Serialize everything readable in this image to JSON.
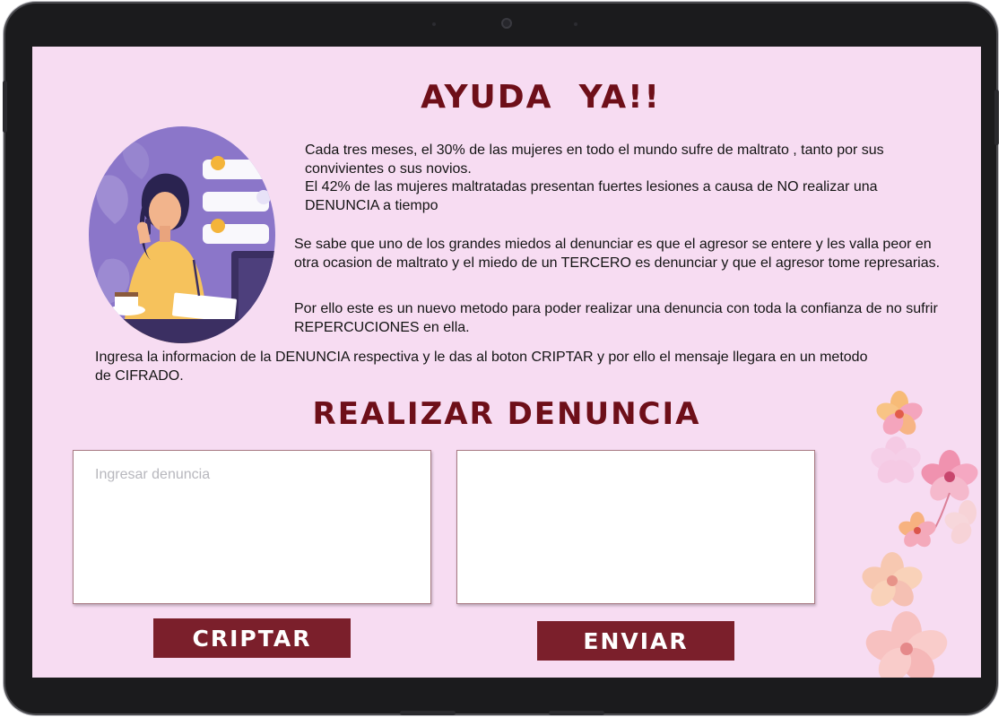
{
  "page": {
    "title": "AYUDA  YA!!",
    "paragraphs": [
      "Cada tres meses, el 30% de las mujeres en todo el mundo sufre de maltrato , tanto por sus convivientes o sus novios.",
      "El 42% de las mujeres maltratadas presentan fuertes lesiones a causa de NO realizar una DENUNCIA a tiempo",
      "Se sabe que uno de los grandes miedos al denunciar es que el agresor se entere y les valla peor en otra ocasion de maltrato y el miedo de un TERCERO es denunciar y que el agresor tome represarias.",
      "Por ello este es un nuevo metodo para poder realizar una denuncia con toda la confianza de no sufrir REPERCUCIONES en ella.",
      "Ingresa la informacion de la DENUNCIA respectiva y le das al boton CRIPTAR y por ello el mensaje llegara en un metodo de CIFRADO."
    ],
    "form_title": "REALIZAR DENUNCIA"
  },
  "form": {
    "input": {
      "placeholder": "Ingresar denuncia",
      "value": ""
    },
    "output": {
      "value": ""
    },
    "encrypt_label": "CRIPTAR",
    "send_label": "ENVIAR"
  },
  "colors": {
    "background": "#f7dcf2",
    "accent": "#7b1f2b",
    "title": "#6e0f19"
  }
}
